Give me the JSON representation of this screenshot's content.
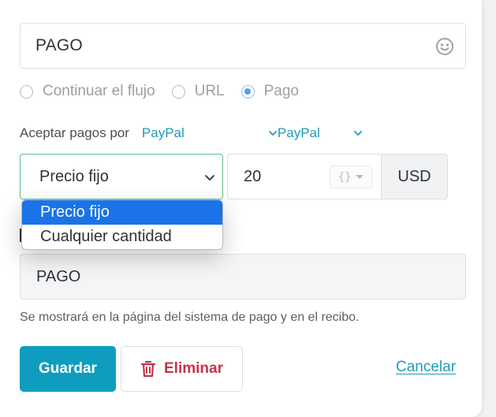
{
  "button_text": {
    "value": "PAGO"
  },
  "action_options": [
    {
      "label": "Continuar el flujo",
      "checked": false
    },
    {
      "label": "URL",
      "checked": false
    },
    {
      "label": "Pago",
      "checked": true
    }
  ],
  "payments": {
    "label": "Aceptar pagos por",
    "provider_1": "PayPal",
    "provider_2": "PayPal"
  },
  "price": {
    "type_selected": "Precio fijo",
    "amount": "20",
    "variable_icon": "{}",
    "currency": "USD"
  },
  "price_type_dropdown": {
    "options": [
      "Precio fijo",
      "Cualquier cantidad"
    ],
    "highlighted": "Precio fijo"
  },
  "description": {
    "value": "PAGO",
    "helper": "Se mostrará en la página del sistema de pago y en el recibo."
  },
  "actions": {
    "save_label": "Guardar",
    "delete_label": "Eliminar",
    "cancel_label": "Cancelar"
  },
  "colors": {
    "accent": "#0f9dbf",
    "link": "#1f9bb6",
    "danger": "#c4344a",
    "selection": "#1a73e8",
    "focus_border": "#5cc08a"
  }
}
